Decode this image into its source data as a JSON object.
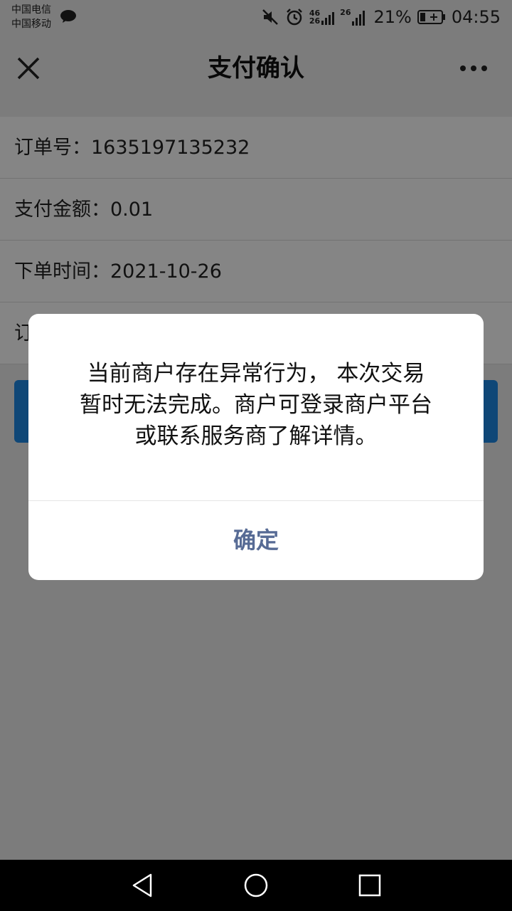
{
  "status_bar": {
    "carrier_1": "中国电信",
    "carrier_2": "中国移动",
    "network_1": "46",
    "network_2": "26",
    "network_3": "26",
    "battery": "21%",
    "time": "04:55",
    "icons": [
      "wechat-icon",
      "mute-icon",
      "alarm-icon",
      "signal-icon",
      "battery-icon"
    ]
  },
  "nav": {
    "title": "支付确认",
    "close_icon": "close-icon",
    "more_icon": "more-icon"
  },
  "order": {
    "rows": [
      "订单号：1635197135232",
      "支付金额：0.01",
      "下单时间：2021-10-26",
      "订"
    ]
  },
  "dialog": {
    "message_lines": [
      "当前商户存在异常行为， 本次交易",
      "暂时无法完成。商户可登录商户平台",
      "或联系服务商了解详情。"
    ],
    "confirm_label": "确定"
  },
  "colors": {
    "accent": "#576b95",
    "pay_button": "#1e88e5",
    "overlay": "rgba(0,0,0,0.48)"
  },
  "system_nav": {
    "icons": [
      "back-icon",
      "home-icon",
      "recent-apps-icon"
    ]
  }
}
